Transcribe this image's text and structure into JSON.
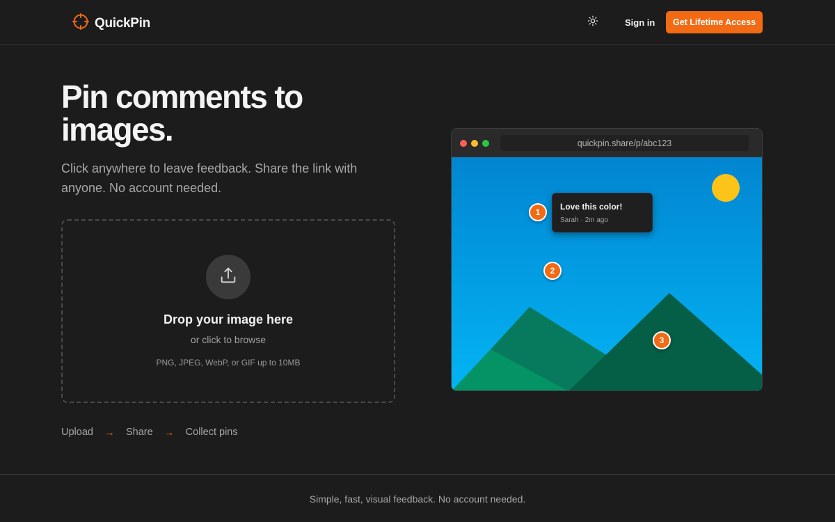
{
  "header": {
    "brand": "QuickPin",
    "brand_icon": "crosshair-icon",
    "theme_icon": "sun-icon",
    "signin_label": "Sign in",
    "cta_label": "Get Lifetime Access",
    "accent_color": "#f26a14"
  },
  "hero": {
    "title": "Pin comments to images.",
    "subtitle": "Click anywhere to leave feedback. Share the link with anyone. No account needed."
  },
  "dropzone": {
    "icon": "upload-icon",
    "title": "Drop your image here",
    "browse": "or click to browse",
    "formats": "PNG, JPEG, WebP, or GIF up to 10MB"
  },
  "steps": {
    "items": [
      "Upload",
      "Share",
      "Collect pins"
    ],
    "arrow": "→"
  },
  "preview": {
    "url": "quickpin.share/p/abc123",
    "pins": [
      "1",
      "2",
      "3"
    ],
    "comment": {
      "text": "Love this color!",
      "meta": "Sarah · 2m ago"
    }
  },
  "footer": {
    "text": "Simple, fast, visual feedback. No account needed."
  }
}
